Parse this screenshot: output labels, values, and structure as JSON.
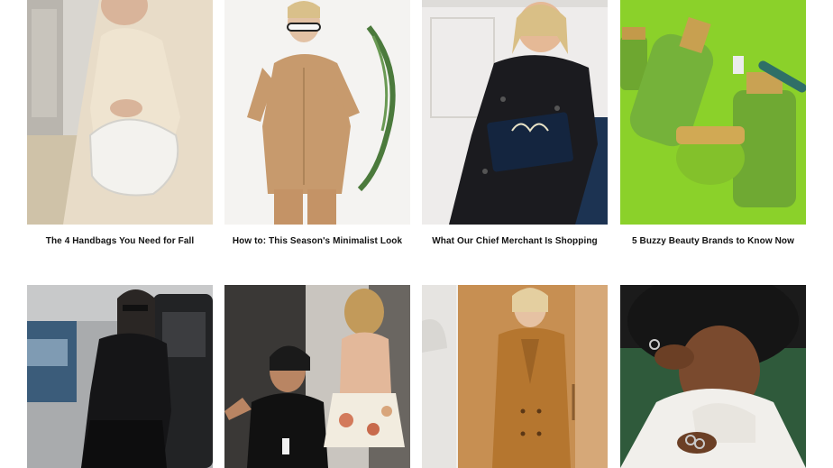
{
  "articles": [
    {
      "title": "The 4 Handbags You Need for Fall",
      "image": "woman-with-white-handbag"
    },
    {
      "title": "How to: This Season's Minimalist Look",
      "image": "woman-in-camel-outfit-sunglasses"
    },
    {
      "title": "What Our Chief Merchant Is Shopping",
      "image": "woman-in-sequin-dress"
    },
    {
      "title": "5 Buzzy Beauty Brands to Know Now",
      "image": "green-beauty-bottles"
    },
    {
      "title": "",
      "image": "street-style-woman-black-outfit"
    },
    {
      "title": "",
      "image": "backstage-fashion-show"
    },
    {
      "title": "",
      "image": "woman-in-camel-coat"
    },
    {
      "title": "",
      "image": "woman-in-white-sweater-rings"
    }
  ]
}
